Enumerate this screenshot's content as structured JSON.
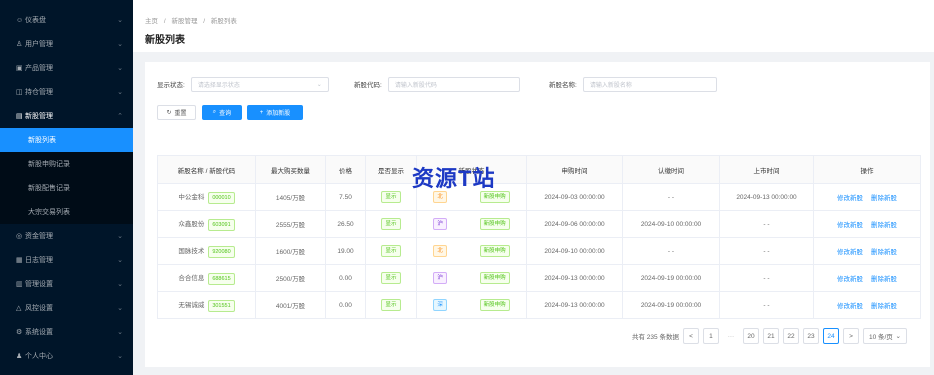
{
  "sidebar": {
    "items": [
      {
        "icon": "☺",
        "label": "仪表盘",
        "expanded": false
      },
      {
        "icon": "♙",
        "label": "用户管理",
        "expanded": false
      },
      {
        "icon": "▣",
        "label": "产品管理",
        "expanded": false
      },
      {
        "icon": "◫",
        "label": "持仓管理",
        "expanded": false
      },
      {
        "icon": "▤",
        "label": "新股管理",
        "expanded": true,
        "children": [
          "新股列表",
          "新股申购记录",
          "新股配售记录",
          "大宗交易列表"
        ],
        "active_child": 0
      },
      {
        "icon": "◎",
        "label": "资金管理",
        "expanded": false
      },
      {
        "icon": "▦",
        "label": "日志管理",
        "expanded": false
      },
      {
        "icon": "▥",
        "label": "管理设置",
        "expanded": false
      },
      {
        "icon": "△",
        "label": "风控设置",
        "expanded": false
      },
      {
        "icon": "⚙",
        "label": "系统设置",
        "expanded": false
      },
      {
        "icon": "♟",
        "label": "个人中心",
        "expanded": false
      }
    ]
  },
  "breadcrumb": [
    "主页",
    "/",
    "新股管理",
    "/",
    "新股列表"
  ],
  "page_title": "新股列表",
  "filters": {
    "status_label": "显示状态:",
    "status_placeholder": "请选择显示状态",
    "code_label": "新股代码:",
    "code_placeholder": "请输入新股代码",
    "name_label": "新股名称:",
    "name_placeholder": "请输入新股名称"
  },
  "buttons": {
    "reset": "重置",
    "search": "查询",
    "add": "添加新股"
  },
  "table": {
    "headers": [
      "新股名称 / 新股代码",
      "最大购买数量",
      "价格",
      "是否显示",
      "新股状态",
      "申购时间",
      "认缴时间",
      "上市时间",
      "操作"
    ],
    "rows": [
      {
        "name": "中公金科",
        "code": "000010",
        "max": "1405/万股",
        "price": "7.50",
        "show": "显示",
        "board": "北",
        "status": "新股申购",
        "apply": "2024-09-03 00:00:00",
        "pay": "- -",
        "list": "2024-09-13 00:00:00",
        "ops": [
          "修改新股",
          "删除新股"
        ]
      },
      {
        "name": "众鑫股份",
        "code": "603091",
        "max": "2555/万股",
        "price": "26.50",
        "show": "显示",
        "board": "沪",
        "status": "新股申购",
        "apply": "2024-09-06 00:00:00",
        "pay": "2024-09-10 00:00:00",
        "list": "- -",
        "ops": [
          "修改新股",
          "删除新股"
        ]
      },
      {
        "name": "国脉技术",
        "code": "920080",
        "max": "1600/万股",
        "price": "19.00",
        "show": "显示",
        "board": "北",
        "status": "新股申购",
        "apply": "2024-09-10 00:00:00",
        "pay": "- -",
        "list": "- -",
        "ops": [
          "修改新股",
          "删除新股"
        ]
      },
      {
        "name": "合合信息",
        "code": "688615",
        "max": "2500/万股",
        "price": "0.00",
        "show": "显示",
        "board": "沪",
        "status": "新股申购",
        "apply": "2024-09-13 00:00:00",
        "pay": "2024-09-19 00:00:00",
        "list": "- -",
        "ops": [
          "修改新股",
          "删除新股"
        ]
      },
      {
        "name": "无锡诚威",
        "code": "301551",
        "max": "4001/万股",
        "price": "0.00",
        "show": "显示",
        "board": "深",
        "status": "新股申购",
        "apply": "2024-09-13 00:00:00",
        "pay": "2024-09-19 00:00:00",
        "list": "- -",
        "ops": [
          "修改新股",
          "删除新股"
        ]
      }
    ]
  },
  "watermark": "资源T站",
  "pagination": {
    "total_text": "共有 235 条数据",
    "prev": "<",
    "first": "1",
    "ellipsis": "···",
    "pages": [
      "20",
      "21",
      "22",
      "23",
      "24"
    ],
    "current": "24",
    "next": ">",
    "page_size": "10 条/页"
  },
  "colors": {
    "sidebar_bg": "#001529",
    "accent": "#1890ff",
    "success": "#52c41a"
  }
}
